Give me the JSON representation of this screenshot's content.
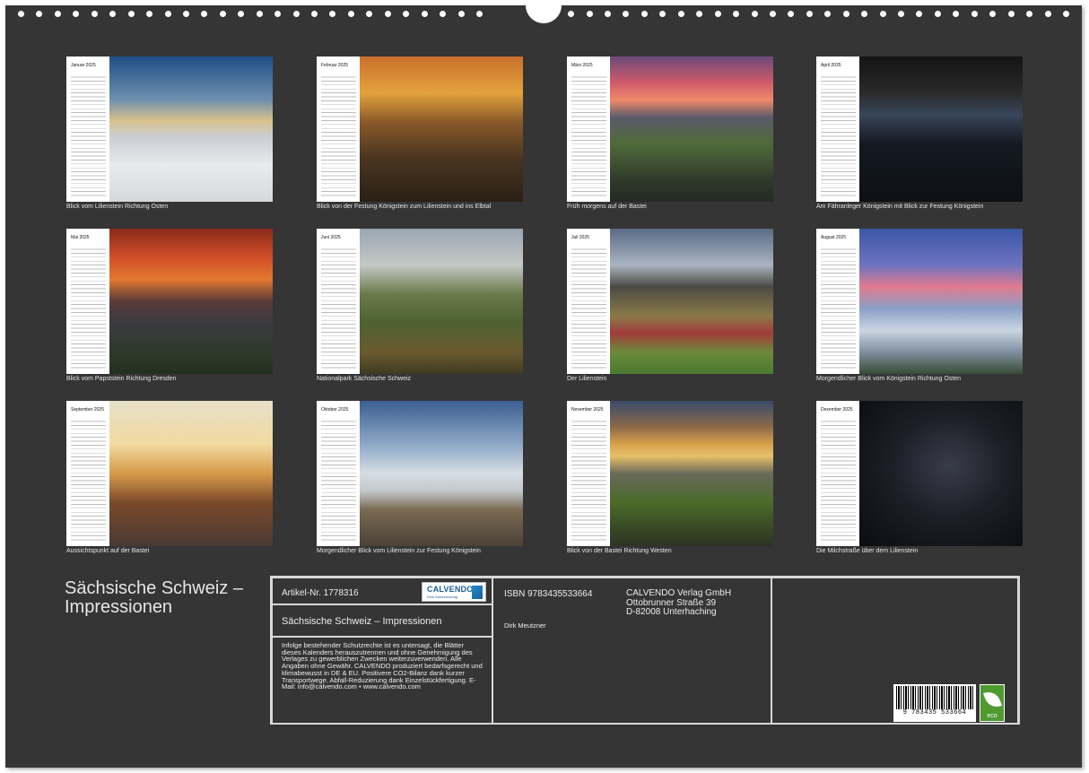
{
  "months": [
    {
      "name": "Januar 2025",
      "caption": "Blick vom Lilienstein Richtung Osten"
    },
    {
      "name": "Februar 2025",
      "caption": "Blick von der Festung Königstein zum Lilienstein und ins Elbtal"
    },
    {
      "name": "März 2025",
      "caption": "Früh morgens auf der Bastei"
    },
    {
      "name": "April 2025",
      "caption": "Am Fähranleger Königstein mit Blick zur Festung Königstein"
    },
    {
      "name": "Mai 2025",
      "caption": "Blick vom Papststein Richtung Dresden"
    },
    {
      "name": "Juni 2025",
      "caption": "Nationalpark Sächsische Schweiz"
    },
    {
      "name": "Juli 2025",
      "caption": "Der Lilienstein"
    },
    {
      "name": "August 2025",
      "caption": "Morgendlicher Blick vom Königstein Richtung Osten"
    },
    {
      "name": "September 2025",
      "caption": "Aussichtspunkt auf der Bastei"
    },
    {
      "name": "Oktober 2025",
      "caption": "Morgendlicher Blick vom Lilienstein zur Festung Königstein"
    },
    {
      "name": "November 2025",
      "caption": "Blick von der Bastei Richtung Westen"
    },
    {
      "name": "Dezember 2025",
      "caption": "Die Milchstraße über dem Lilienstein"
    }
  ],
  "calendar_title": "Sächsische Schweiz – Impressionen",
  "info": {
    "article_number": "Artikel-Nr. 1778316",
    "logo_text": "CALVENDO",
    "logo_subtext": "Dein Autorenverlag",
    "product_name": "Sächsische Schweiz – Impressionen",
    "legal_text": "Infolge bestehender Schutzrechte ist es untersagt, die Blätter dieses Kalenders herauszutrennen und ohne Genehmigung des Verlages zu gewerblichen Zwecken weiterzuverwenden. Alle Angaben ohne Gewähr. CALVENDO produziert bedarfsgerecht und klimabewusst in DE & EU. Positivere CO2-Bilanz dank kurzer Transportwege. Abfall-Reduzierung dank Einzelstückfertigung. E-Mail: info@calvendo.com • www.calvendo.com",
    "isbn": "ISBN 9783435533664",
    "publisher_line1": "CALVENDO Verlag GmbH",
    "publisher_line2": "Ottobrunner Straße 39",
    "publisher_line3": "D-82008 Unterhaching",
    "author": "Dirk Meutzner",
    "barcode_number": "9 783435 533664",
    "eco_label": "eco"
  }
}
